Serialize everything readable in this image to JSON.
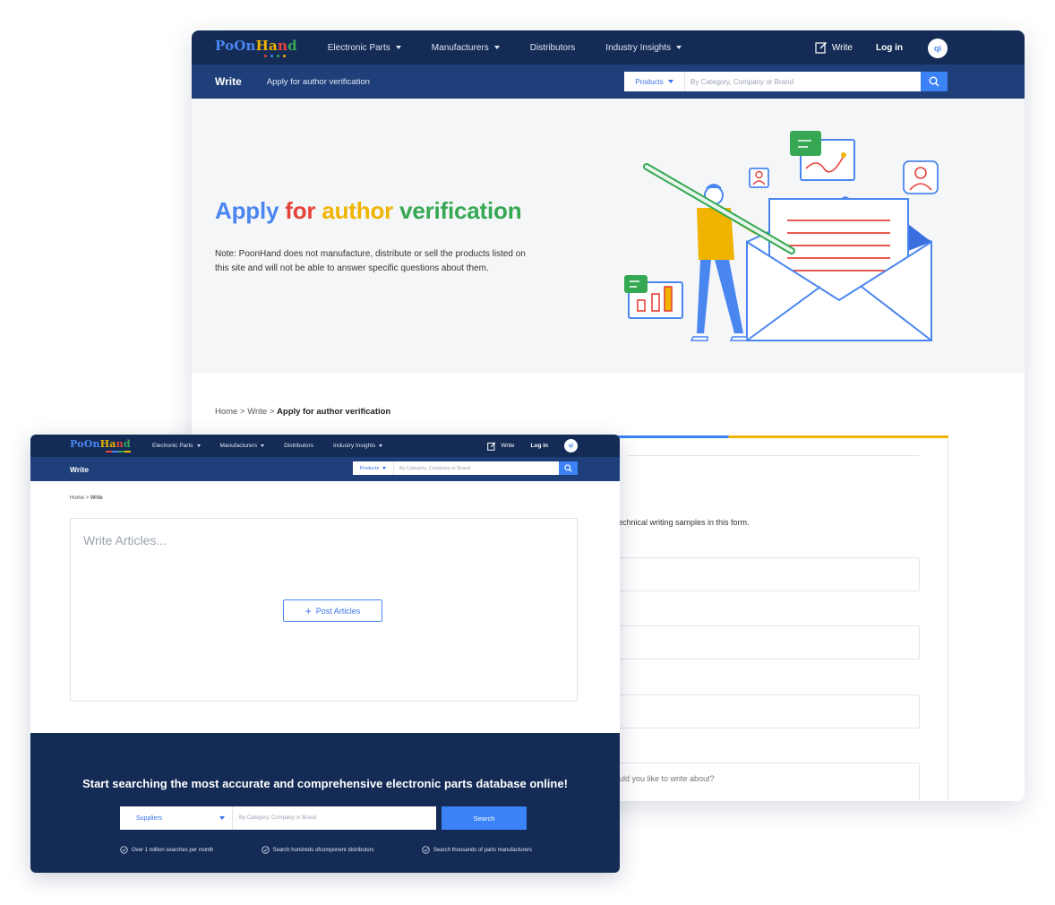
{
  "back_window": {
    "logo": {
      "part1": "PoOn",
      "part2": "Ha",
      "part3": "n",
      "part4": "d"
    },
    "nav": [
      "Electronic Parts",
      "Manufacturers",
      "Distributors",
      "Industry Insights"
    ],
    "write_label": "Write",
    "login_label": "Log in",
    "avatar_initials": "qi",
    "subnav_title": "Write",
    "subnav_subtitle": "Apply for author verification",
    "search": {
      "category": "Products",
      "placeholder": "By Category, Company or Brand"
    },
    "hero": {
      "title_words": [
        "Apply",
        "for",
        "author",
        "verification"
      ],
      "note": "Note: PoonHand does not manufacture, distribute or sell the products listed on this site and will not be able to answer specific questions about them."
    },
    "breadcrumb": {
      "home": "Home",
      "sep": ">",
      "write": "Write",
      "current": "Apply for author verification"
    },
    "form": {
      "note_fragment": "echnical writing samples in this form.",
      "last_field_placeholder_fragment": "uld you like to write about?"
    }
  },
  "front_window": {
    "logo": {
      "part1": "PoOn",
      "part2": "Ha",
      "part3": "n",
      "part4": "d"
    },
    "nav": [
      "Electronic Parts",
      "Manufacturers",
      "Distributors",
      "Industry Insights"
    ],
    "write_label": "Write",
    "login_label": "Log in",
    "avatar_initials": "qi",
    "subnav_title": "Write",
    "search": {
      "category": "Products",
      "placeholder": "By Category, Company or Brand"
    },
    "breadcrumb": {
      "home": "Home",
      "sep": ">",
      "current": "Write"
    },
    "article_placeholder": "Write Articles...",
    "post_button": "Post Articles",
    "footer": {
      "title": "Start searching the most accurate and comprehensive electronic parts database online!",
      "search_category": "Suppliers",
      "search_placeholder": "By Category, Company or Brand",
      "search_button": "Search",
      "features": [
        "Over 1 million searches per month",
        "Search hundreds ofcomponent distributors",
        "Search thousands of parts manufacturers"
      ]
    }
  },
  "colors": {
    "navy": "#142b55",
    "subnav": "#1f3f7a",
    "accent": "#3b82f6",
    "red": "#e5423a",
    "yellow": "#f0b400",
    "green": "#36a853"
  }
}
